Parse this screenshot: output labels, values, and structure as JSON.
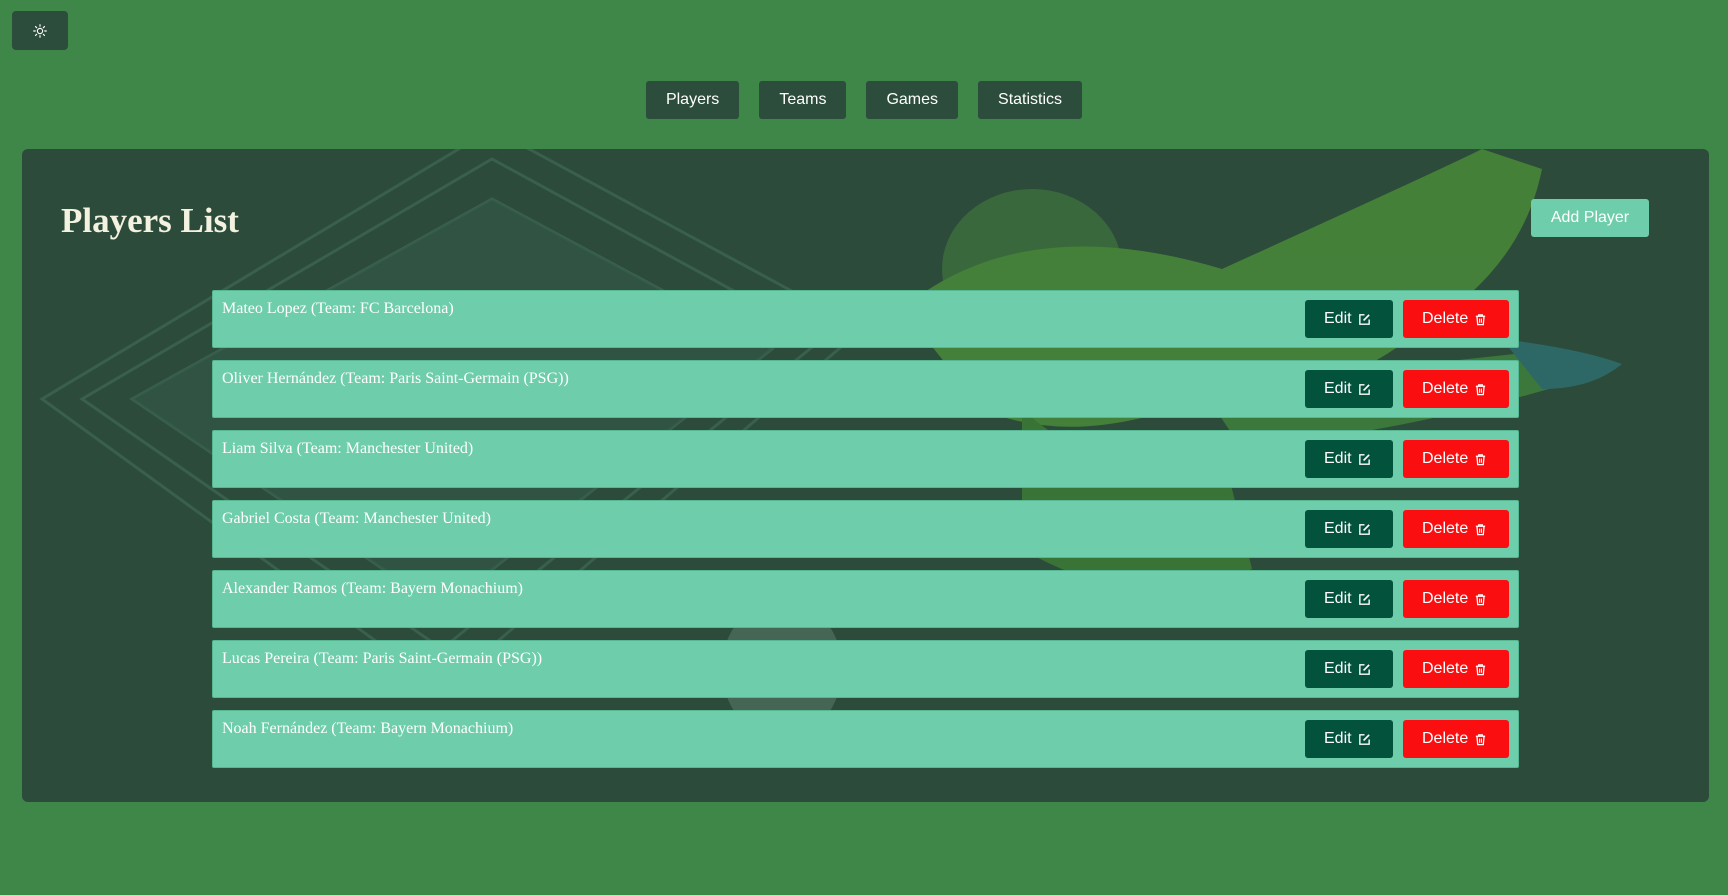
{
  "theme_toggle": {
    "icon": "sun-icon"
  },
  "nav": {
    "items": [
      {
        "label": "Players"
      },
      {
        "label": "Teams"
      },
      {
        "label": "Games"
      },
      {
        "label": "Statistics"
      }
    ]
  },
  "main": {
    "title": "Players List",
    "add_label": "Add Player",
    "edit_label": "Edit",
    "delete_label": "Delete",
    "edit_icon": "edit-icon",
    "delete_icon": "trash-icon",
    "players": [
      {
        "text": "Mateo Lopez (Team: FC Barcelona)"
      },
      {
        "text": "Oliver Hernández (Team: Paris Saint-Germain (PSG))"
      },
      {
        "text": "Liam Silva (Team: Manchester United)"
      },
      {
        "text": "Gabriel Costa (Team: Manchester United)"
      },
      {
        "text": "Alexander Ramos (Team: Bayern Monachium)"
      },
      {
        "text": "Lucas Pereira (Team: Paris Saint-Germain (PSG))"
      },
      {
        "text": "Noah Fernández (Team: Bayern Monachium)"
      }
    ]
  },
  "colors": {
    "page_bg": "#3e8748",
    "panel_bg": "#2c4b3a",
    "row_bg": "#6ecdab",
    "edit_bg": "#03523b",
    "delete_bg": "#fb0e10",
    "nav_bg": "#2d4d3c"
  }
}
